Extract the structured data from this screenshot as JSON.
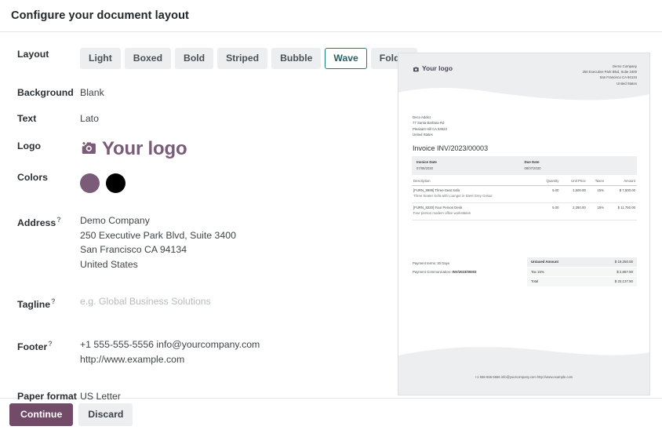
{
  "dialog": {
    "title": "Configure your document layout",
    "continue_label": "Continue",
    "discard_label": "Discard"
  },
  "form": {
    "layout": {
      "label": "Layout",
      "options": [
        "Light",
        "Boxed",
        "Bold",
        "Striped",
        "Bubble",
        "Wave",
        "Folder"
      ],
      "selected": "Wave"
    },
    "background": {
      "label": "Background",
      "value": "Blank"
    },
    "text": {
      "label": "Text",
      "value": "Lato"
    },
    "logo": {
      "label": "Logo",
      "value": "Your logo",
      "icon": "camera-icon"
    },
    "colors": {
      "label": "Colors",
      "primary": "#7a5b78",
      "secondary": "#000000"
    },
    "address": {
      "label": "Address",
      "help": "?",
      "lines": [
        "Demo Company",
        "250 Executive Park Blvd, Suite 3400",
        "San Francisco CA 94134",
        "United States"
      ]
    },
    "tagline": {
      "label": "Tagline",
      "help": "?",
      "value": "",
      "placeholder": "e.g. Global Business Solutions"
    },
    "footer": {
      "label": "Footer",
      "help": "?",
      "lines": [
        "+1 555-555-5556 info@yourcompany.com",
        "http://www.example.com"
      ]
    },
    "paper_format": {
      "label": "Paper format",
      "value": "US Letter"
    }
  },
  "preview": {
    "logo_text": "Your logo",
    "company_address": [
      "Demo Company",
      "250 Executive Park Blvd, Suite 3400",
      "San Francisco CA 94134",
      "United States"
    ],
    "recipient_address": [
      "Deco Addict",
      "77 Santa Barbara Rd",
      "Pleasant Hill CA 94523",
      "United States"
    ],
    "invoice_title": "Invoice INV/2023/00003",
    "invoice_date_label": "Invoice Date",
    "invoice_date_value": "07/08/2030",
    "due_date_label": "Due Date",
    "due_date_value": "08/07/2030",
    "table": {
      "headers": [
        "Description",
        "Quantity",
        "Unit Price",
        "Taxes",
        "Amount"
      ],
      "rows": [
        {
          "description": "[FURN_8999] Three-Seat Sofa",
          "sub": "Three Seater Sofa with Lounger in Steel Grey Colour",
          "quantity": "5.00",
          "unit_price": "1,500.00",
          "taxes": "15%",
          "amount": "$ 7,500.00"
        },
        {
          "description": "[FURN_8220] Four Person Desk",
          "sub": "Four person modern office workstation",
          "quantity": "5.00",
          "unit_price": "2,350.00",
          "taxes": "15%",
          "amount": "$ 11,750.00"
        }
      ]
    },
    "payment_terms": "Payment terms: 30 Days",
    "payment_communication_label": "Payment Communication: ",
    "payment_communication_value": "INV/2023/00003",
    "totals": [
      {
        "label": "Untaxed Amount",
        "value": "$ 19,250.00",
        "strong": true
      },
      {
        "label": "Tax 15%",
        "value": "$ 2,887.50",
        "strong": false
      },
      {
        "label": "Total",
        "value": "$ 22,137.50",
        "strong": false
      }
    ],
    "footer_text": "+1 555-555-5556 info@yourcompany.com http://www.example.com"
  }
}
